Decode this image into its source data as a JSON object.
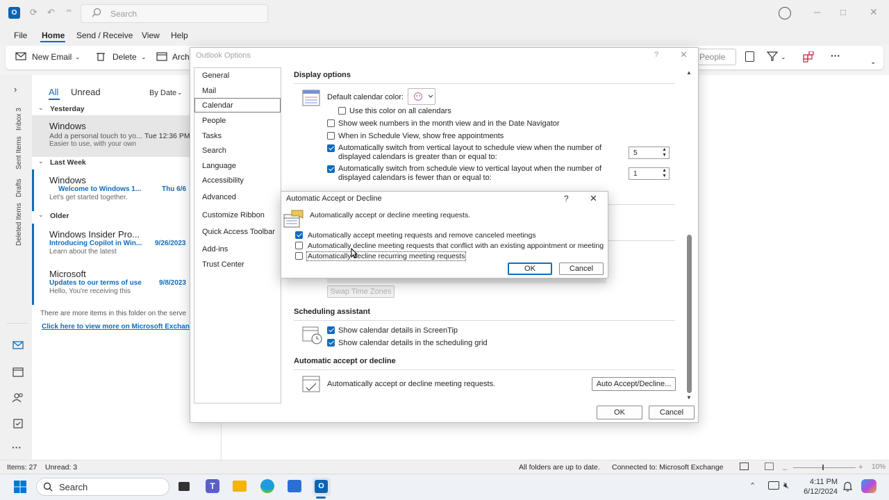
{
  "outlook": {
    "search_placeholder": "Search",
    "menus": [
      "File",
      "Home",
      "Send / Receive",
      "View",
      "Help"
    ],
    "ribbon": {
      "new_email": "New Email",
      "delete": "Delete",
      "archive": "Arch",
      "people_search": "People"
    },
    "rail_labels": [
      "Inbox 3",
      "Sent Items",
      "Drafts",
      "Deleted Items"
    ],
    "list_tabs": {
      "all": "All",
      "unread": "Unread",
      "sort": "By Date"
    },
    "groups": [
      "Yesterday",
      "Last Week",
      "Older"
    ],
    "messages": [
      {
        "sender": "Windows",
        "subject": "Add a personal touch to yo...",
        "date": "Tue 12:36 PM",
        "preview": "Easier to use, with your own"
      },
      {
        "sender": "Windows",
        "subject": "Welcome to Windows 1...",
        "date": "Thu 6/6",
        "preview": "Let's get started together."
      },
      {
        "sender": "Windows Insider Pro...",
        "subject": "Introducing Copilot in Win...",
        "date": "9/26/2023",
        "preview": "Learn about the latest"
      },
      {
        "sender": "Microsoft",
        "subject": "Updates to our terms of use",
        "date": "9/8/2023",
        "preview": "Hello, You're receiving this"
      }
    ],
    "more_items": "There are more items in this folder on the serve",
    "more_link": "Click here to view more on Microsoft Exchang",
    "status": {
      "items": "Items: 27",
      "unread": "Unread: 3",
      "sync": "All folders are up to date.",
      "connection": "Connected to: Microsoft Exchange",
      "zoom": "10%"
    }
  },
  "options": {
    "title": "Outlook Options",
    "help": "?",
    "nav": [
      "General",
      "Mail",
      "Calendar",
      "People",
      "Tasks",
      "Search",
      "Language",
      "Accessibility",
      "Advanced",
      "Customize Ribbon",
      "Quick Access Toolbar",
      "Add-ins",
      "Trust Center"
    ],
    "selected_nav": "Calendar",
    "display_options": {
      "heading": "Display options",
      "default_color_label": "Default calendar color:",
      "use_color_all": "Use this color on all calendars",
      "week_numbers": "Show week numbers in the month view and in the Date Navigator",
      "schedule_free": "When in Schedule View, show free appointments",
      "auto_switch_schedule_1": "Automatically switch from vertical layout to schedule view when the number of",
      "auto_switch_schedule_2": "displayed calendars is greater than or equal to:",
      "auto_switch_schedule_value": "5",
      "auto_switch_vertical_1": "Automatically switch from schedule view to vertical layout when the number of",
      "auto_switch_vertical_2": "displayed calendars is fewer than or equal to:",
      "auto_switch_vertical_value": "1"
    },
    "swap_time_zones": "Swap Time Zones",
    "scheduling": {
      "heading": "Scheduling assistant",
      "screentip": "Show calendar details in ScreenTip",
      "grid": "Show calendar details in the scheduling grid"
    },
    "auto_accept": {
      "heading": "Automatic accept or decline",
      "text": "Automatically accept or decline meeting requests.",
      "button": "Auto Accept/Decline..."
    },
    "ok": "OK",
    "cancel": "Cancel"
  },
  "aad_dialog": {
    "title": "Automatic Accept or Decline",
    "help": "?",
    "description": "Automatically accept or decline meeting requests.",
    "opt_accept": "Automatically accept meeting requests and remove canceled meetings",
    "opt_decline_conflict": "Automatically decline meeting requests that conflict with an existing appointment or meeting",
    "opt_decline_recurring": "Automatically decline recurring meeting requests",
    "accept_checked": true,
    "decline_conflict_checked": false,
    "decline_recurring_checked": false,
    "ok": "OK",
    "cancel": "Cancel"
  },
  "taskbar": {
    "search": "Search",
    "time": "4:11 PM",
    "date": "6/12/2024"
  },
  "colors": {
    "accent": "#0f6cbd",
    "outlook_blue": "#0a64b3"
  }
}
